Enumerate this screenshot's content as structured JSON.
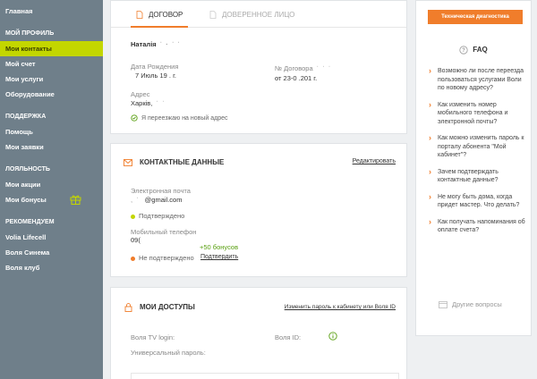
{
  "sidebar": {
    "home": "Главная",
    "profile_header": "Мой профиль",
    "contacts": "Мои контакты",
    "account": "Мой счет",
    "services": "Мои услуги",
    "equipment": "Оборудование",
    "support_header": "Поддержка",
    "help": "Помощь",
    "requests": "Мои заявки",
    "loyalty_header": "Лояльность",
    "promos": "Мои акции",
    "bonuses": "Мои бонусы",
    "recommend_header": "Рекомендуем",
    "lifecell": "Volia Lifecell",
    "cinema": "Воля Синема",
    "club": "Воля клуб"
  },
  "profile": {
    "tab_contract": "Договор",
    "tab_proxy": "Доверенное лицо",
    "name": "Наталія",
    "birth_label": "Дата Рождения",
    "birth_value": "7 Июль 19 . г.",
    "contract_label": "№ Договора",
    "contract_value": "от 23-0 .201 г.",
    "address_label": "Адрес",
    "address_value": "Харків,",
    "moving_link": "Я переезжаю на новый адрес"
  },
  "contacts": {
    "title": "Контактные данные",
    "edit_link": "Редактировать",
    "email_label": "Электронная почта",
    "email_value": "@gmail.com",
    "email_status": "Подтверждено",
    "phone_label": "Мобильный телефон",
    "phone_value": "09(",
    "bonus_text": "+50 бонусов",
    "phone_status": "Не подтверждено",
    "confirm_link": "Подтвердить"
  },
  "access": {
    "title": "Мои доступы",
    "change_pwd_link": "Изменить пароль к кабинету или Воля ID",
    "tv_login_label": "Воля TV login:",
    "volia_id_label": "Воля ID:",
    "universal_pwd_label": "Универсальный пароль:"
  },
  "right": {
    "diag_button": "Техническая диагностика",
    "faq_title": "FAQ",
    "faq": [
      "Возможно ли после переезда пользоваться услугами Воли по новому адресу?",
      "Как изменить номер мобильного телефона и электронной почты?",
      "Как можно изменить пароль к порталу абонента \"Мой кабинет\"?",
      "Зачем подтверждать контактные данные?",
      "Не могу быть дома, когда придет мастер. Что делать?",
      "Как получать напоминания об оплате счета?"
    ],
    "other_questions": "Другие вопросы"
  },
  "colors": {
    "accent": "#f07d2b",
    "active": "#c3d600",
    "sidebar": "#6f7f8a",
    "green": "#5aa012"
  }
}
